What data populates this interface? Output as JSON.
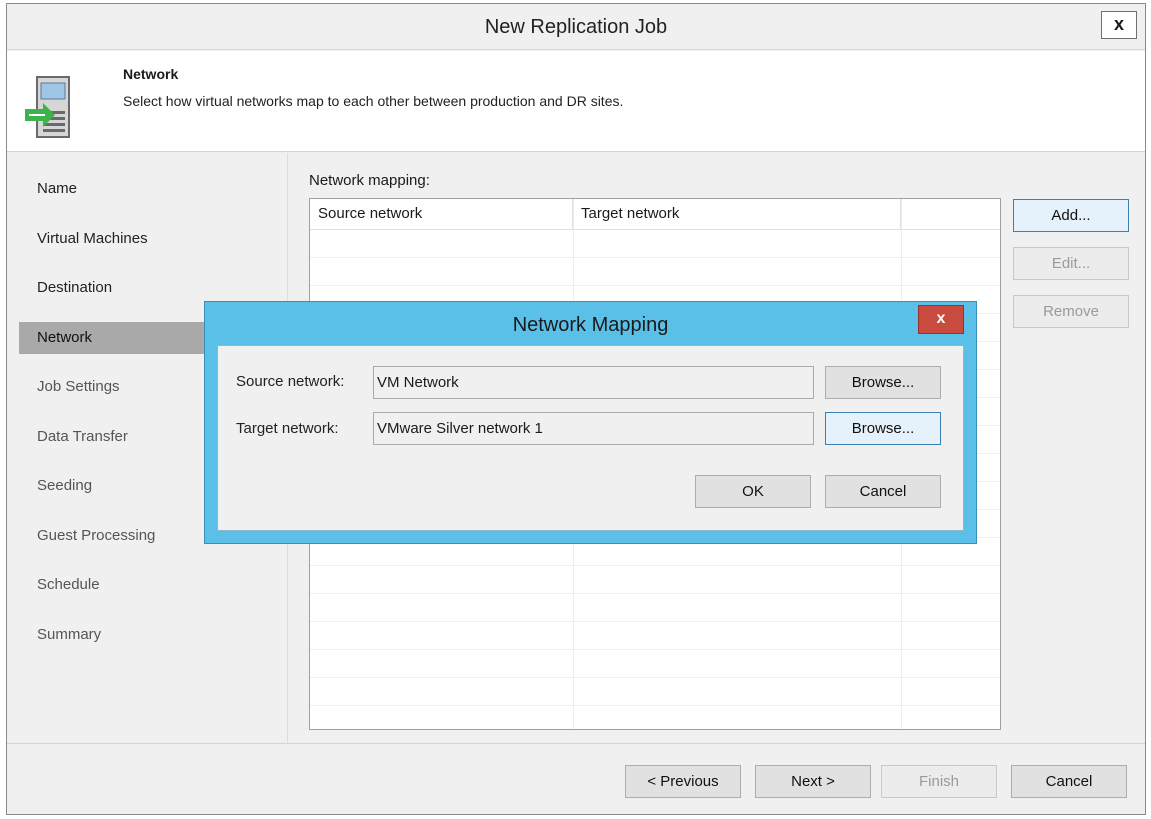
{
  "window": {
    "title": "New Replication Job",
    "close_label": "x"
  },
  "header": {
    "title": "Network",
    "description": "Select how virtual networks map to each other between production and DR sites."
  },
  "sidebar": {
    "items": [
      {
        "label": "Name"
      },
      {
        "label": "Virtual Machines"
      },
      {
        "label": "Destination"
      },
      {
        "label": "Network"
      },
      {
        "label": "Job Settings"
      },
      {
        "label": "Data Transfer"
      },
      {
        "label": "Seeding"
      },
      {
        "label": "Guest Processing"
      },
      {
        "label": "Schedule"
      },
      {
        "label": "Summary"
      }
    ]
  },
  "main": {
    "mapping_label": "Network mapping:",
    "columns": [
      "Source network",
      "Target network"
    ],
    "add_label": "Add...",
    "edit_label": "Edit...",
    "remove_label": "Remove"
  },
  "footer": {
    "previous_label": "< Previous",
    "next_label": "Next >",
    "finish_label": "Finish",
    "cancel_label": "Cancel"
  },
  "modal": {
    "title": "Network Mapping",
    "close_label": "x",
    "source_label": "Source network:",
    "source_value": "VM Network",
    "target_label": "Target network:",
    "target_value": "VMware Silver network 1",
    "browse_label": "Browse...",
    "ok_label": "OK",
    "cancel_label": "Cancel"
  },
  "colors": {
    "modal_frame": "#5bc0e8",
    "close_red": "#c94b3f",
    "active_nav": "#a9a9a9",
    "arrow_green": "#3cb44a"
  }
}
